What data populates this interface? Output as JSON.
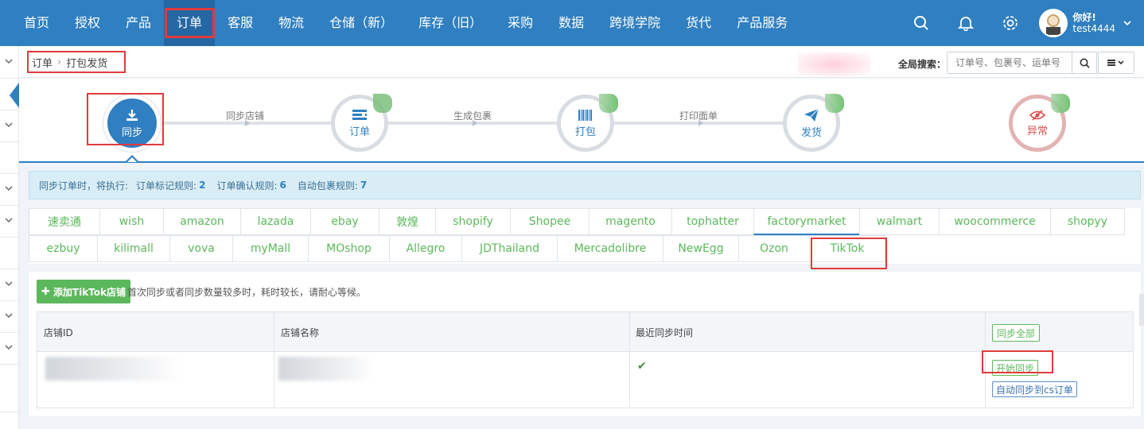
{
  "nav": {
    "items": [
      {
        "label": "首页"
      },
      {
        "label": "授权"
      },
      {
        "label": "产品"
      },
      {
        "label": "订单"
      },
      {
        "label": "客服"
      },
      {
        "label": "物流"
      },
      {
        "label": "仓储（新）"
      },
      {
        "label": "库存（旧）"
      },
      {
        "label": "采购"
      },
      {
        "label": "数据"
      },
      {
        "label": "跨境学院"
      },
      {
        "label": "货代"
      },
      {
        "label": "产品服务"
      }
    ],
    "active_index": 3,
    "icons": [
      "search-icon",
      "bell-icon",
      "gear-icon"
    ]
  },
  "user": {
    "greeting": "你好!",
    "name": "test4444"
  },
  "breadcrumb": {
    "parent": "订单",
    "separator": "›",
    "current": "打包发货"
  },
  "global_search": {
    "label": "全局搜索：",
    "placeholder": "订单号、包裹号、运单号"
  },
  "steps": {
    "items": [
      {
        "label": "同步",
        "icon": "download-icon"
      },
      {
        "label": "订单",
        "icon": "order-list-icon"
      },
      {
        "label": "打包",
        "icon": "barcode-icon"
      },
      {
        "label": "发货",
        "icon": "paper-plane-icon"
      },
      {
        "label": "异常",
        "icon": "eye-slash-icon"
      }
    ],
    "connectors": [
      "同步店铺",
      "生成包裹",
      "打印面单"
    ]
  },
  "info": {
    "prefix": "同步订单时，将执行:",
    "rules": [
      {
        "label": "订单标记规则:",
        "count": "2"
      },
      {
        "label": "订单确认规则:",
        "count": "6"
      },
      {
        "label": "自动包裹规则:",
        "count": "7"
      }
    ]
  },
  "platforms": {
    "row1": [
      "速卖通",
      "wish",
      "amazon",
      "lazada",
      "ebay",
      "敦煌",
      "shopify",
      "Shopee",
      "magento",
      "tophatter",
      "factorymarket",
      "walmart",
      "woocommerce",
      "shopyy"
    ],
    "row2": [
      "ezbuy",
      "kilimall",
      "vova",
      "myMall",
      "MOshop",
      "Allegro",
      "JDThailand",
      "Mercadolibre",
      "NewEgg",
      "Ozon",
      "TikTok"
    ],
    "selected": "TikTok",
    "highlighted": "factorymarket"
  },
  "content": {
    "add_button": "添加TikTok店铺",
    "hint": "首次同步或者同步数量较多时，耗时较长，请耐心等候。",
    "table": {
      "headers": [
        "店铺ID",
        "店铺名称",
        "最近同步时间"
      ],
      "sync_all": "同步全部",
      "row": {
        "check": "✔",
        "start_sync": "开始同步",
        "auto_sync": "自动同步到cs订单"
      }
    }
  },
  "colors": {
    "primary": "#2f7fc1",
    "green": "#5cb85c",
    "highlight": "#e03b3b"
  }
}
